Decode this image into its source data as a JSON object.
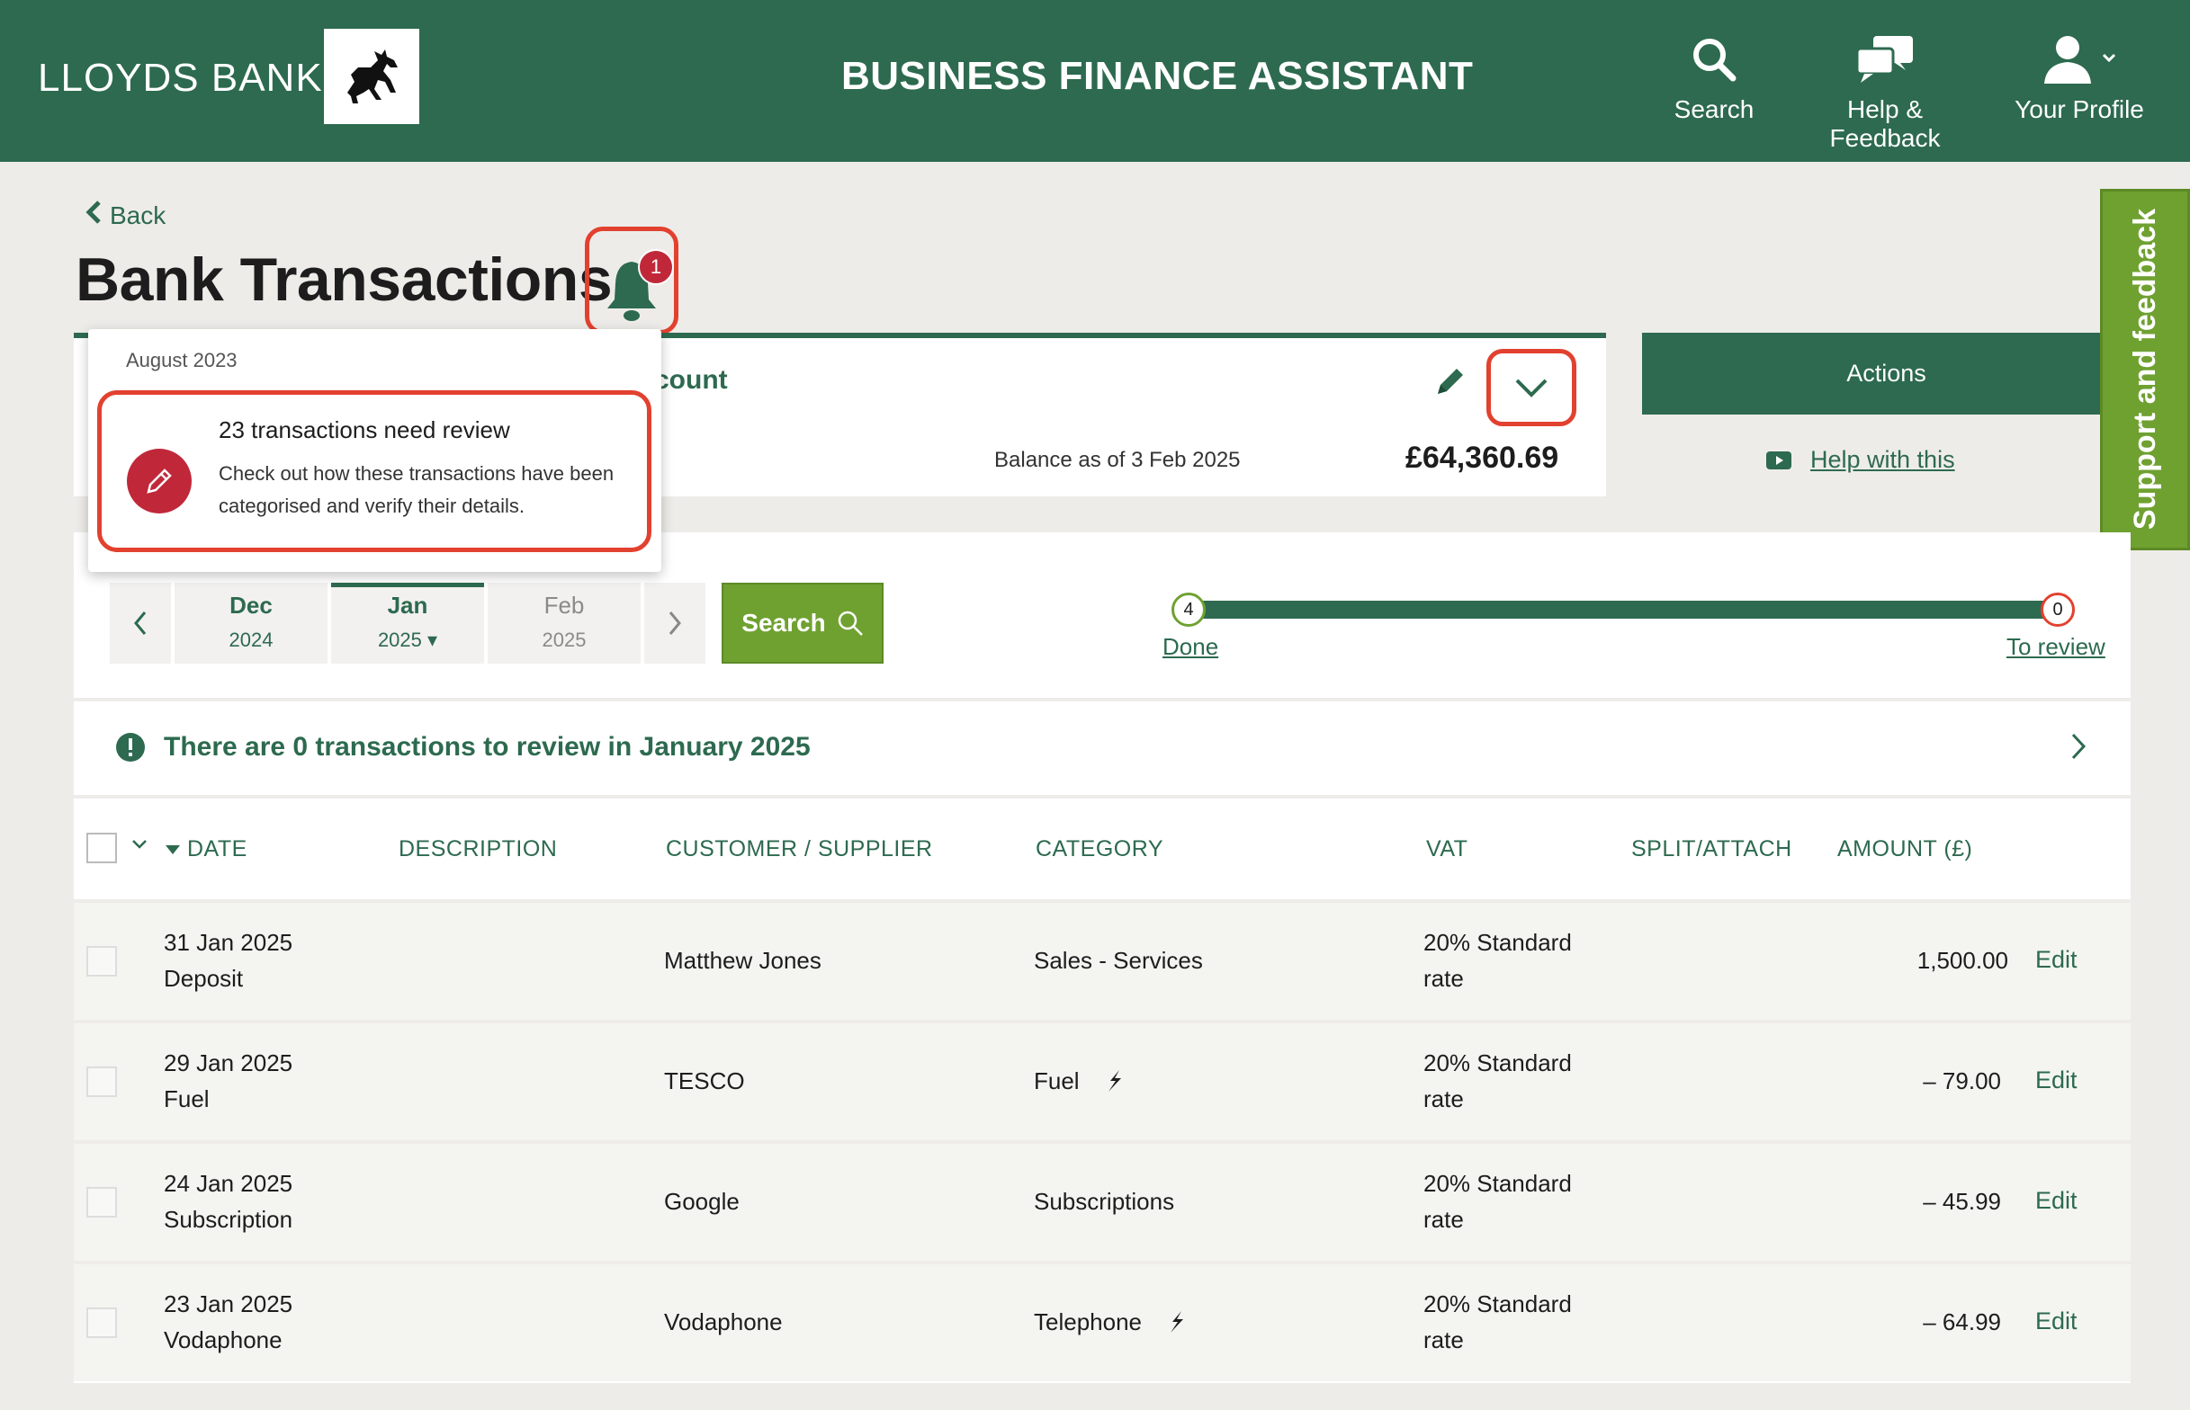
{
  "header": {
    "brand": "LLOYDS BANK",
    "app_title": "BUSINESS FINANCE ASSISTANT",
    "nav": [
      {
        "label": "Search",
        "icon": "search-icon"
      },
      {
        "label": "Help & Feedback",
        "icon": "chat-bubbles-icon"
      },
      {
        "label": "Your Profile",
        "icon": "user-icon"
      }
    ]
  },
  "page": {
    "back_label": "Back",
    "title": "Bank Transactions",
    "notification_count": "1"
  },
  "notification_popup": {
    "month": "August 2023",
    "heading": "23 transactions need review",
    "body": "Check out how these transactions have been categorised and verify their details."
  },
  "account": {
    "name_partial": "count",
    "balance_label": "Balance as of 3 Feb 2025",
    "balance_value": "£64,360.69"
  },
  "actions": {
    "label": "Actions",
    "help_link": "Help with this"
  },
  "support_tab": "Support and feedback",
  "date_nav": {
    "months": [
      {
        "month": "Dec",
        "year": "2024"
      },
      {
        "month": "Jan",
        "year": "2025 ▾"
      },
      {
        "month": "Feb",
        "year": "2025"
      }
    ],
    "search_label": "Search"
  },
  "progress": {
    "done_count": "4",
    "done_label": "Done",
    "review_count": "0",
    "review_label": "To review"
  },
  "info_banner": "There are 0 transactions to review in January 2025",
  "table": {
    "columns": [
      "DATE",
      "DESCRIPTION",
      "CUSTOMER / SUPPLIER",
      "CATEGORY",
      "VAT",
      "SPLIT/ATTACH",
      "AMOUNT (£)"
    ],
    "rows": [
      {
        "date": "31 Jan 2025",
        "desc": "Deposit",
        "party": "Matthew Jones",
        "category": "Sales - Services",
        "auto": false,
        "vat1": "20% Standard",
        "vat2": "rate",
        "amount": "1,500.00",
        "edit": "Edit"
      },
      {
        "date": "29 Jan 2025",
        "desc": "Fuel",
        "party": "TESCO",
        "category": "Fuel",
        "auto": true,
        "vat1": "20% Standard",
        "vat2": "rate",
        "amount": "– 79.00",
        "edit": "Edit"
      },
      {
        "date": "24 Jan 2025",
        "desc": "Subscription",
        "party": "Google",
        "category": "Subscriptions",
        "auto": false,
        "vat1": "20% Standard",
        "vat2": "rate",
        "amount": "– 45.99",
        "edit": "Edit"
      },
      {
        "date": "23 Jan 2025",
        "desc": "Vodaphone",
        "party": "Vodaphone",
        "category": "Telephone",
        "auto": true,
        "vat1": "20% Standard",
        "vat2": "rate",
        "amount": "– 64.99",
        "edit": "Edit"
      }
    ]
  },
  "colors": {
    "brand_green": "#2d6a4f",
    "accent_green": "#6fa131",
    "highlight_red": "#e2412f",
    "badge_red": "#c0283a"
  }
}
